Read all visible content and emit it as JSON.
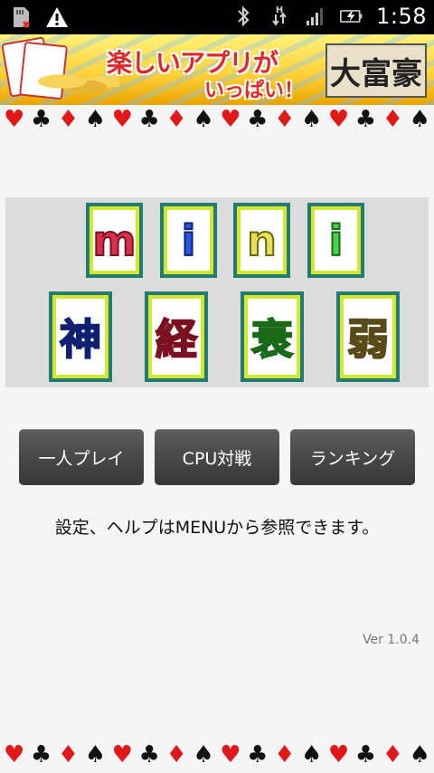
{
  "status_bar": {
    "time": "1:58",
    "left_icons": [
      "sd-card-icon",
      "warning-icon"
    ],
    "right_icons": [
      "bluetooth-icon",
      "data-transfer-icon",
      "signal-icon",
      "battery-charging-icon"
    ],
    "data_badge": "H"
  },
  "banner": {
    "text_main": "楽しいアプリが",
    "text_sub": "いっぱい！",
    "game_name": "大富豪"
  },
  "suit_row": [
    "♥",
    "♣",
    "♦",
    "♠",
    "♥",
    "♣",
    "♦",
    "♠",
    "♥",
    "♣",
    "♦",
    "♠",
    "♥",
    "♣",
    "♦",
    "♠"
  ],
  "title": {
    "row1": [
      "m",
      "i",
      "n",
      "i"
    ],
    "row2": [
      "神",
      "経",
      "衰",
      "弱"
    ]
  },
  "buttons": {
    "single_play": "一人プレイ",
    "cpu_battle": "CPU対戦",
    "ranking": "ランキング"
  },
  "help_text": "設定、ヘルプはMENUから参照できます。",
  "version": "Ver 1.0.4"
}
